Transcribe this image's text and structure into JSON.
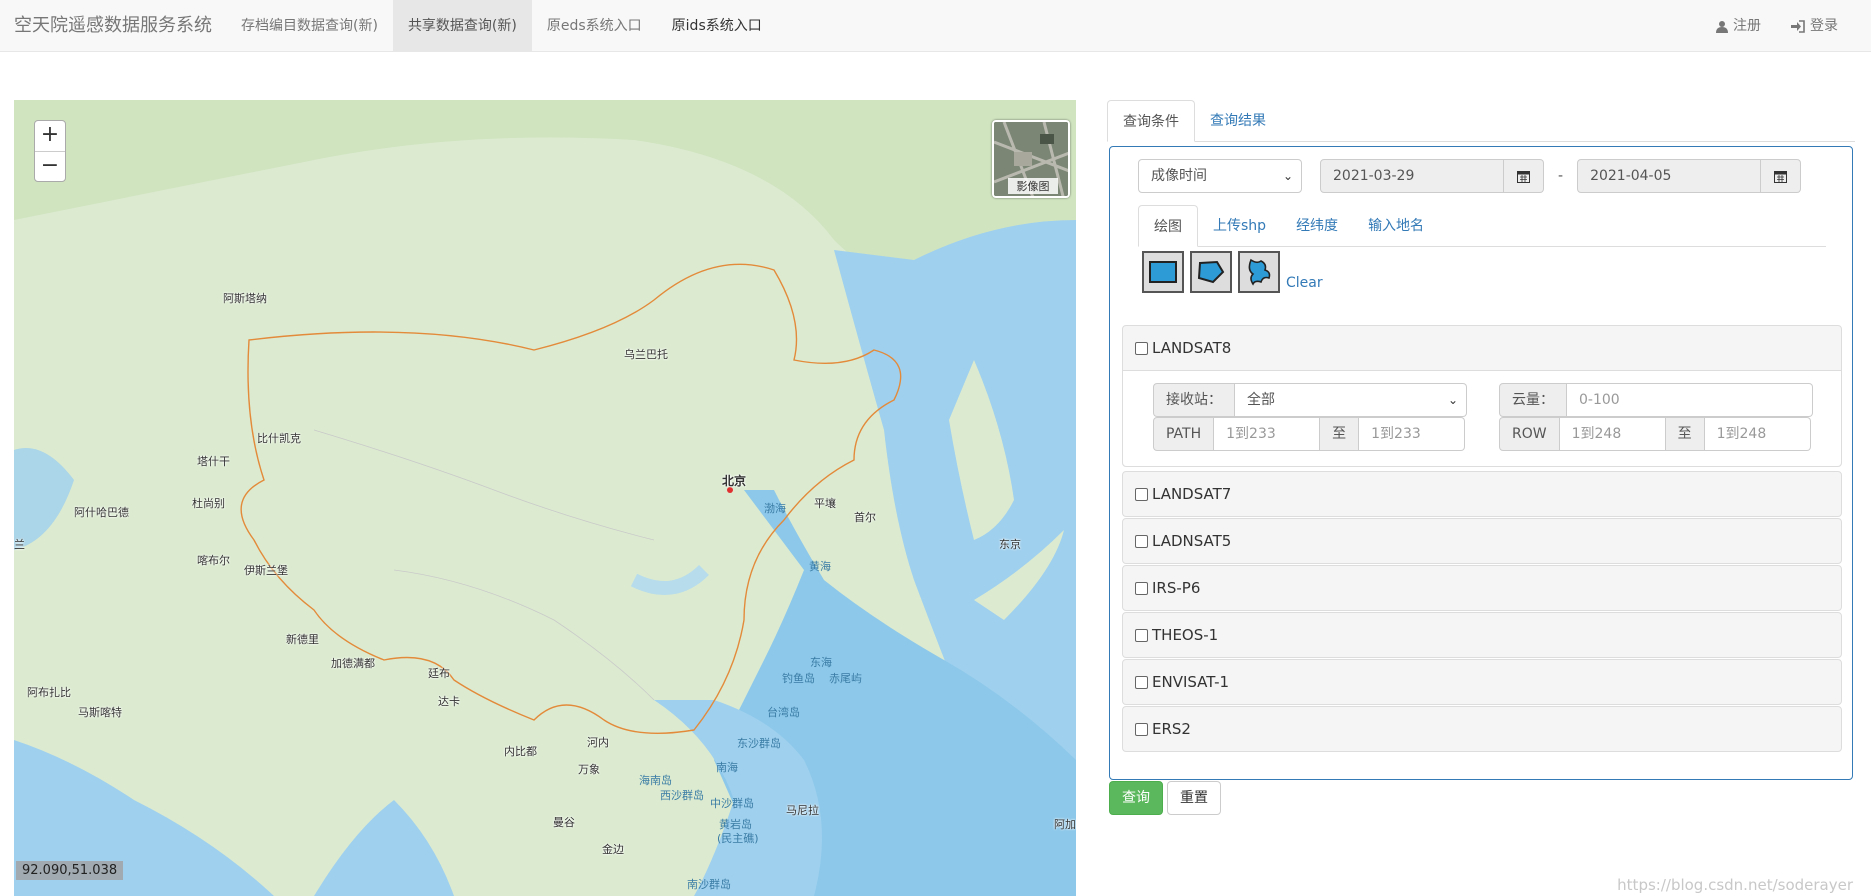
{
  "navbar": {
    "brand": "空天院遥感数据服务系统",
    "links": [
      "存档编目数据查询(新)",
      "共享数据查询(新)",
      "原eds系统入口",
      "原ids系统入口"
    ],
    "register": "注册",
    "login": "登录"
  },
  "map": {
    "zoom_in": "+",
    "zoom_out": "−",
    "layer_label": "影像图",
    "coords": "92.090,51.038",
    "labels": {
      "astana": "阿斯塔纳",
      "ulaanbaatar": "乌兰巴托",
      "bishkek": "比什凯克",
      "tashkent": "塔什干",
      "dushanbe": "杜尚别",
      "ashgabat": "阿什哈巴德",
      "kabul": "喀布尔",
      "islamabad": "伊斯兰堡",
      "newdelhi": "新德里",
      "kathmandu": "加德满都",
      "thimphu": "廷布",
      "dhaka": "达卡",
      "abudhabi": "阿布扎比",
      "muscat": "马斯喀特",
      "beijing": "北京",
      "bohai": "渤海",
      "pyongyang": "平壤",
      "seoul": "首尔",
      "tokyo": "东京",
      "yellowsea": "黄海",
      "eastsea": "东海",
      "diaoyu": "钓鱼岛",
      "chiwei": "赤尾屿",
      "taiwan": "台湾岛",
      "hanoi": "河内",
      "naypyidaw": "内比都",
      "vientiane": "万象",
      "hainan": "海南岛",
      "dongsha": "东沙群岛",
      "southsea": "南海",
      "xisha": "西沙群岛",
      "zhongsha": "中沙群岛",
      "huangyan": "黄岩岛",
      "minzhu": "(民主礁)",
      "manila": "马尼拉",
      "bangkok": "曼谷",
      "phnompenh": "金边",
      "nansha": "南沙群岛",
      "edge_left": "兰",
      "edge_right": "阿加"
    }
  },
  "panel": {
    "tabs": [
      "查询条件",
      "查询结果"
    ],
    "time_type": "成像时间",
    "date_from": "2021-03-29",
    "date_to": "2021-04-05",
    "dash": "-",
    "subtabs": [
      "绘图",
      "上传shp",
      "经纬度",
      "输入地名"
    ],
    "clear": "Clear",
    "landsat8": {
      "name": "LANDSAT8",
      "station_label": "接收站：",
      "station_value": "全部",
      "cloud_label": "云量：",
      "cloud_placeholder": "0-100",
      "path_label": "PATH",
      "path_from": "1到233",
      "to": "至",
      "path_to": "1到233",
      "row_label": "ROW",
      "row_from": "1到248",
      "row_to": "1到248"
    },
    "satellites": [
      "LANDSAT7",
      "LADNSAT5",
      "IRS-P6",
      "THEOS-1",
      "ENVISAT-1",
      "ERS2"
    ]
  },
  "buttons": {
    "query": "查询",
    "reset": "重置"
  },
  "watermark": "https://blog.csdn.net/soderayer",
  "colors": {
    "accent": "#337ab7",
    "primary_button": "#5cb85c",
    "land": "#dcebd0",
    "sea": "#9fd0ee",
    "border_line": "#e38a3a"
  }
}
